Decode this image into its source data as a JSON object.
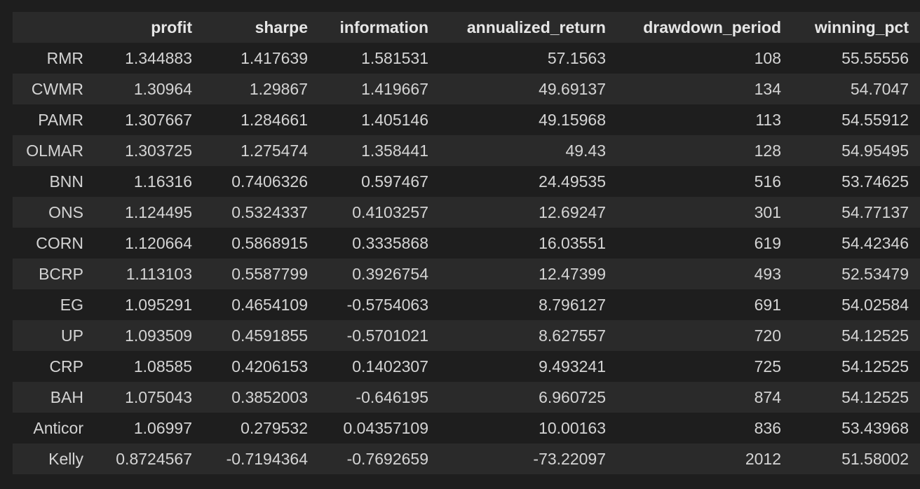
{
  "table": {
    "columns": [
      "",
      "profit",
      "sharpe",
      "information",
      "annualized_return",
      "drawdown_period",
      "winning_pct"
    ],
    "rows": [
      [
        "RMR",
        "1.344883",
        "1.417639",
        "1.581531",
        "57.1563",
        "108",
        "55.55556"
      ],
      [
        "CWMR",
        "1.30964",
        "1.29867",
        "1.419667",
        "49.69137",
        "134",
        "54.7047"
      ],
      [
        "PAMR",
        "1.307667",
        "1.284661",
        "1.405146",
        "49.15968",
        "113",
        "54.55912"
      ],
      [
        "OLMAR",
        "1.303725",
        "1.275474",
        "1.358441",
        "49.43",
        "128",
        "54.95495"
      ],
      [
        "BNN",
        "1.16316",
        "0.7406326",
        "0.597467",
        "24.49535",
        "516",
        "53.74625"
      ],
      [
        "ONS",
        "1.124495",
        "0.5324337",
        "0.4103257",
        "12.69247",
        "301",
        "54.77137"
      ],
      [
        "CORN",
        "1.120664",
        "0.5868915",
        "0.3335868",
        "16.03551",
        "619",
        "54.42346"
      ],
      [
        "BCRP",
        "1.113103",
        "0.5587799",
        "0.3926754",
        "12.47399",
        "493",
        "52.53479"
      ],
      [
        "EG",
        "1.095291",
        "0.4654109",
        "-0.5754063",
        "8.796127",
        "691",
        "54.02584"
      ],
      [
        "UP",
        "1.093509",
        "0.4591855",
        "-0.5701021",
        "8.627557",
        "720",
        "54.12525"
      ],
      [
        "CRP",
        "1.08585",
        "0.4206153",
        "0.1402307",
        "9.493241",
        "725",
        "54.12525"
      ],
      [
        "BAH",
        "1.075043",
        "0.3852003",
        "-0.646195",
        "6.960725",
        "874",
        "54.12525"
      ],
      [
        "Anticor",
        "1.06997",
        "0.279532",
        "0.04357109",
        "10.00163",
        "836",
        "53.43968"
      ],
      [
        "Kelly",
        "0.8724567",
        "-0.7194364",
        "-0.7692659",
        "-73.22097",
        "2012",
        "51.58002"
      ]
    ]
  },
  "colors": {
    "background": "#1e1e1e",
    "stripe": "#2a2a2a",
    "text": "#d4d4d4",
    "header_text": "#e6e6e6"
  }
}
